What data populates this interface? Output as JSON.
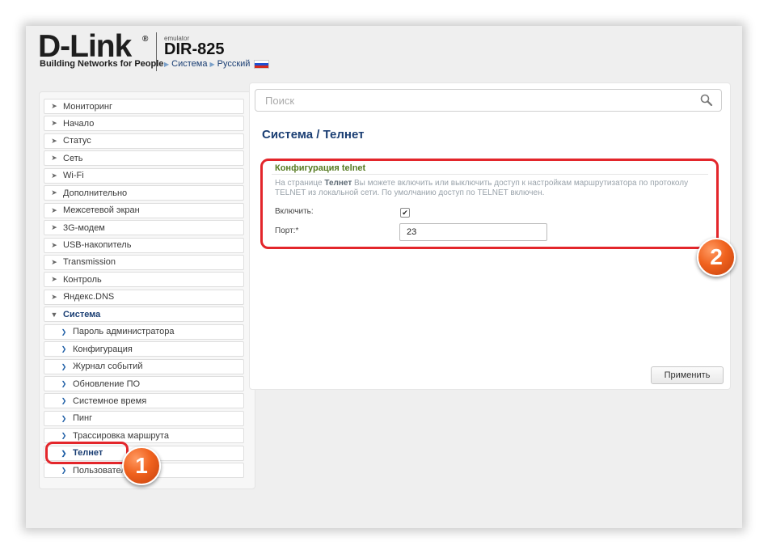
{
  "header": {
    "logo": "D-Link",
    "logo_mark": "®",
    "tagline": "Building Networks for People",
    "emulator_label": "emulator",
    "model": "DIR-825",
    "breadcrumb": [
      "Система",
      "Русский"
    ]
  },
  "search": {
    "placeholder": "Поиск",
    "icon": "search-icon"
  },
  "sidebar": {
    "items": [
      {
        "label": "Мониторинг"
      },
      {
        "label": "Начало"
      },
      {
        "label": "Статус"
      },
      {
        "label": "Сеть"
      },
      {
        "label": "Wi-Fi"
      },
      {
        "label": "Дополнительно"
      },
      {
        "label": "Межсетевой экран"
      },
      {
        "label": "3G-модем"
      },
      {
        "label": "USB-накопитель"
      },
      {
        "label": "Transmission"
      },
      {
        "label": "Контроль"
      },
      {
        "label": "Яндекс.DNS"
      },
      {
        "label": "Система"
      },
      {
        "label": "Пароль администратора"
      },
      {
        "label": "Конфигурация"
      },
      {
        "label": "Журнал событий"
      },
      {
        "label": "Обновление ПО"
      },
      {
        "label": "Системное время"
      },
      {
        "label": "Пинг"
      },
      {
        "label": "Трассировка маршрута"
      },
      {
        "label": "Телнет"
      },
      {
        "label": "Пользователи"
      }
    ]
  },
  "main": {
    "page_title": "Система /  Телнет",
    "section_title": "Конфигурация telnet",
    "description_pre": "На странице ",
    "description_bold": "Телнет",
    "description_post": " Вы можете включить или выключить доступ к настройкам маршрутизатора по протоколу TELNET из локальной сети. По умолчанию доступ по TELNET включен.",
    "enable_label": "Включить:",
    "enable_checked": true,
    "check_mark": "✔",
    "port_label": "Порт:*",
    "port_value": "23",
    "apply_label": "Применить"
  },
  "annotations": {
    "badge1": "1",
    "badge2": "2",
    "highlight_color": "#e3262b",
    "badge_color": "#f0621e"
  }
}
